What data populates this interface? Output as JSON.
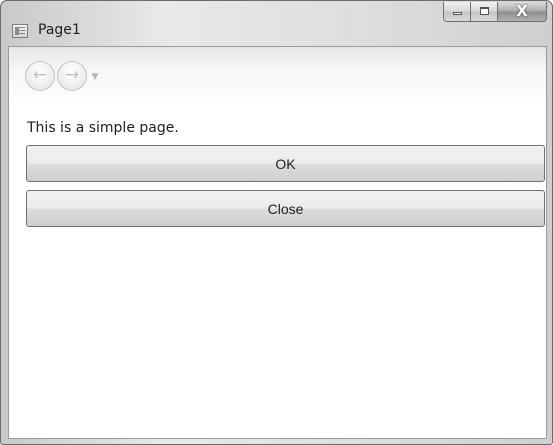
{
  "window": {
    "title": "Page1",
    "icon": "app-page-icon",
    "caption_buttons": {
      "minimize_icon": "minimize-icon",
      "maximize_icon": "maximize-icon",
      "close_icon": "close-icon",
      "close_glyph": "X"
    }
  },
  "navigation": {
    "back_icon": "back-arrow-icon",
    "back_glyph": "←",
    "forward_icon": "forward-arrow-icon",
    "forward_glyph": "→",
    "dropdown_glyph": "▼"
  },
  "page": {
    "text": "This is a simple page.",
    "buttons": {
      "ok_label": "OK",
      "close_label": "Close"
    }
  },
  "colors": {
    "frame": "#dedede",
    "client_background": "#ffffff",
    "text": "#1e1e1e"
  }
}
